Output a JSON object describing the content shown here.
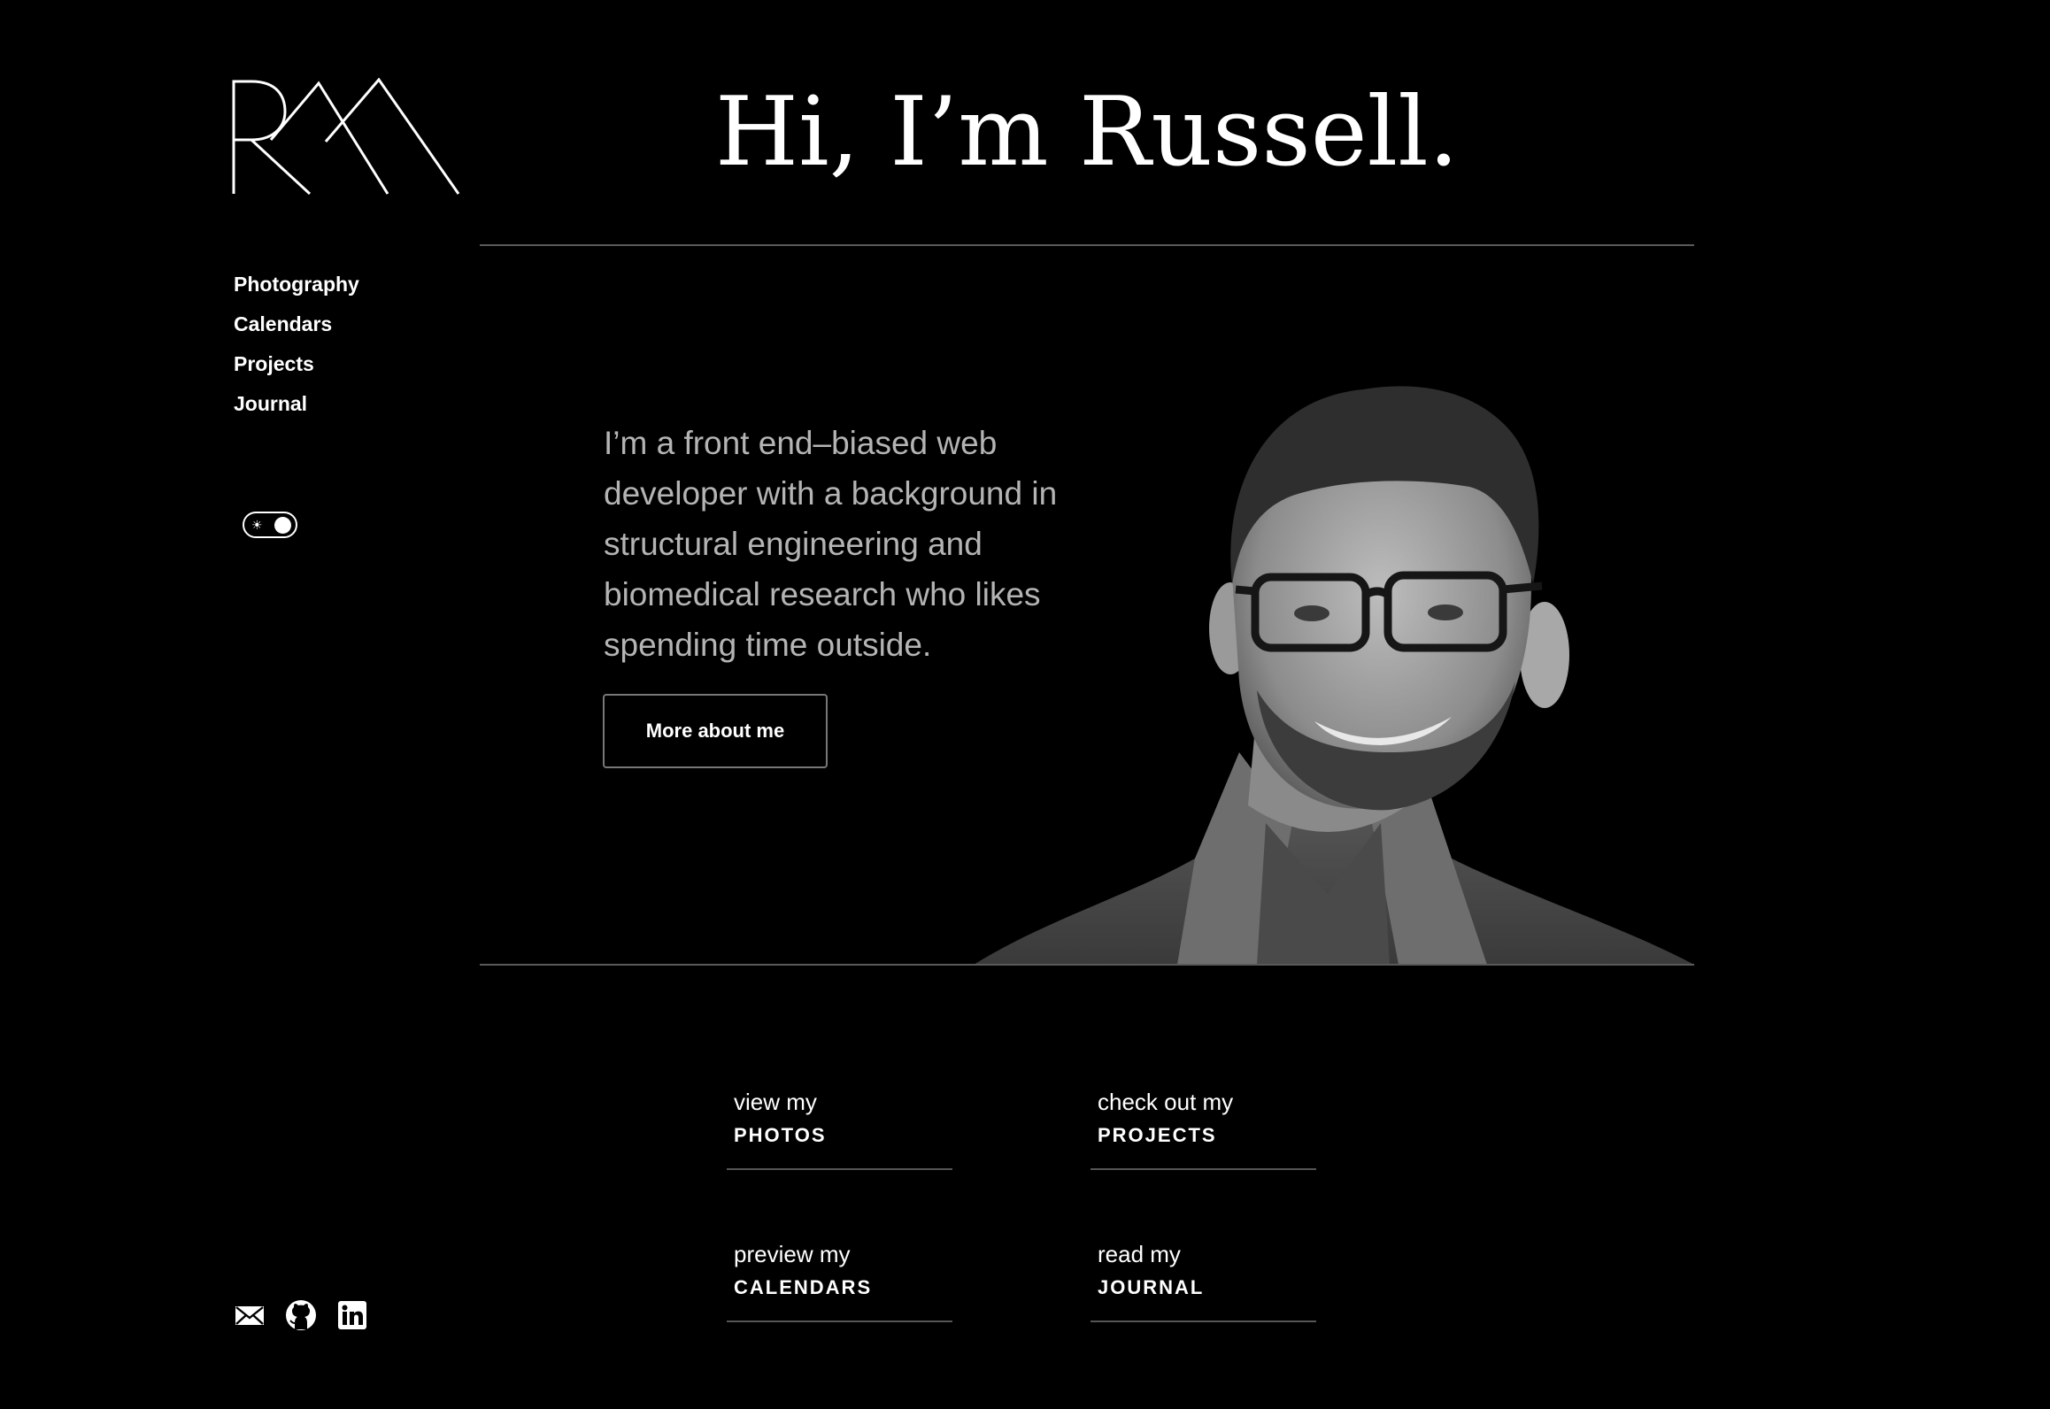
{
  "site": {
    "logo_text": "RM",
    "nav": [
      {
        "label": "Photography"
      },
      {
        "label": "Calendars"
      },
      {
        "label": "Projects"
      },
      {
        "label": "Journal"
      }
    ],
    "theme_toggle": {
      "icon": "sun-icon",
      "state": "dark"
    }
  },
  "hero": {
    "title": "Hi, I’m Russell.",
    "intro": "I’m a front end–biased web developer with a background in structural engineering and biomedical research who likes spending time outside.",
    "button_label": "More about me",
    "portrait_icon": "portrait-photo"
  },
  "ctas": [
    {
      "small": "view my",
      "big": "PHOTOS"
    },
    {
      "small": "check out my",
      "big": "PROJECTS"
    },
    {
      "small": "preview my",
      "big": "CALENDARS"
    },
    {
      "small": "read my",
      "big": "JOURNAL"
    }
  ],
  "social": [
    {
      "icon": "mail-icon"
    },
    {
      "icon": "github-icon"
    },
    {
      "icon": "linkedin-icon"
    }
  ],
  "colors": {
    "background": "#000000",
    "text": "#ffffff",
    "intro_text": "#b4b4b4",
    "rule": "#5a5a5a"
  }
}
